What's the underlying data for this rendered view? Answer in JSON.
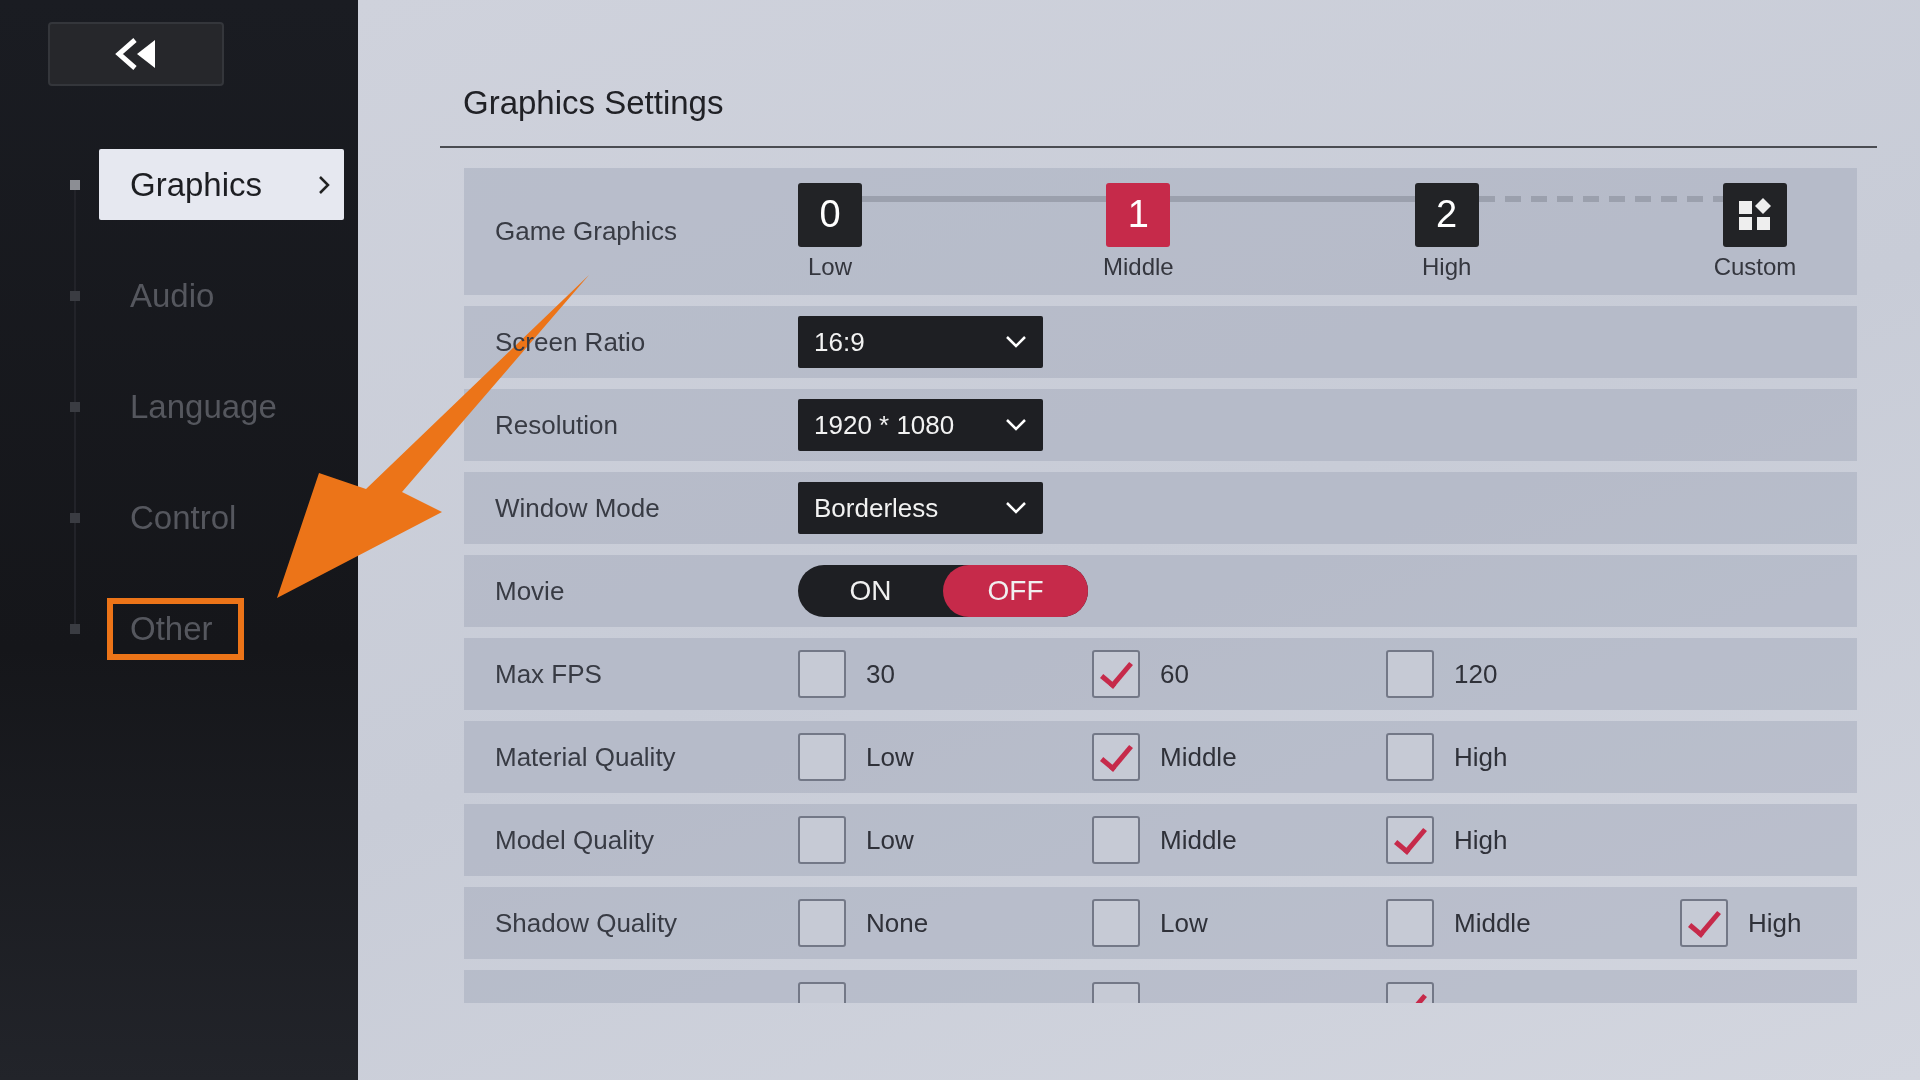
{
  "sidebar": {
    "items": [
      {
        "label": "Graphics",
        "selected": true,
        "highlighted": false
      },
      {
        "label": "Audio",
        "selected": false,
        "highlighted": false
      },
      {
        "label": "Language",
        "selected": false,
        "highlighted": false
      },
      {
        "label": "Control",
        "selected": false,
        "highlighted": false
      },
      {
        "label": "Other",
        "selected": false,
        "highlighted": true
      }
    ]
  },
  "panel": {
    "title": "Graphics Settings",
    "rows": [
      {
        "kind": "levels",
        "label": "Game Graphics",
        "steps": [
          {
            "number": "0",
            "label": "Low",
            "selected": false,
            "kind": "preset"
          },
          {
            "number": "1",
            "label": "Middle",
            "selected": true,
            "kind": "preset"
          },
          {
            "number": "2",
            "label": "High",
            "selected": false,
            "kind": "preset"
          },
          {
            "label": "Custom",
            "selected": false,
            "kind": "custom"
          }
        ]
      },
      {
        "kind": "dropdown",
        "label": "Screen Ratio",
        "value": "16:9"
      },
      {
        "kind": "dropdown",
        "label": "Resolution",
        "value": "1920 * 1080"
      },
      {
        "kind": "dropdown",
        "label": "Window Mode",
        "value": "Borderless"
      },
      {
        "kind": "toggle",
        "label": "Movie",
        "options": [
          {
            "label": "ON",
            "selected": false
          },
          {
            "label": "OFF",
            "selected": true
          }
        ]
      },
      {
        "kind": "checkboxes",
        "label": "Max FPS",
        "options": [
          {
            "label": "30",
            "checked": false
          },
          {
            "label": "60",
            "checked": true
          },
          {
            "label": "120",
            "checked": false
          }
        ]
      },
      {
        "kind": "checkboxes",
        "label": "Material Quality",
        "options": [
          {
            "label": "Low",
            "checked": false
          },
          {
            "label": "Middle",
            "checked": true
          },
          {
            "label": "High",
            "checked": false
          }
        ]
      },
      {
        "kind": "checkboxes",
        "label": "Model Quality",
        "options": [
          {
            "label": "Low",
            "checked": false
          },
          {
            "label": "Middle",
            "checked": false
          },
          {
            "label": "High",
            "checked": true
          }
        ]
      },
      {
        "kind": "checkboxes",
        "label": "Shadow Quality",
        "options": [
          {
            "label": "None",
            "checked": false
          },
          {
            "label": "Low",
            "checked": false
          },
          {
            "label": "Middle",
            "checked": false
          },
          {
            "label": "High",
            "checked": true
          }
        ]
      },
      {
        "kind": "checkboxes",
        "options": [
          {
            "checked": false
          },
          {
            "checked": false
          },
          {
            "checked": true
          }
        ]
      }
    ]
  }
}
